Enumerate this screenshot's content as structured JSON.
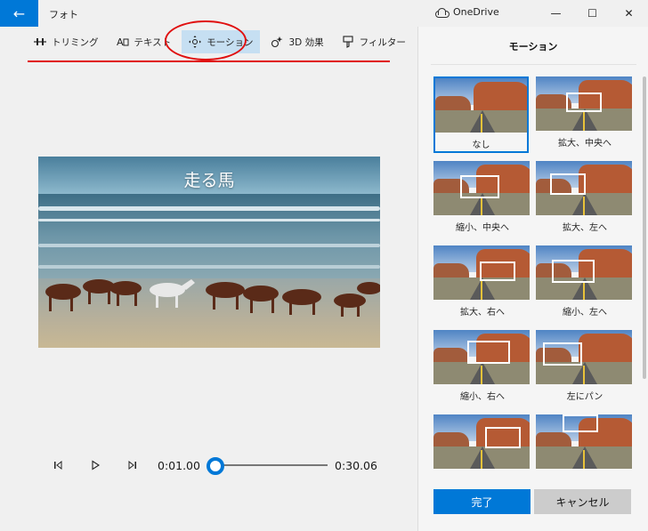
{
  "window": {
    "app_title": "フォト",
    "onedrive_label": "OneDrive",
    "minimize": "—",
    "maximize": "☐",
    "close": "✕"
  },
  "toolbar": {
    "items": [
      {
        "label": "トリミング",
        "icon": "trim-icon"
      },
      {
        "label": "テキスト",
        "icon": "text-icon"
      },
      {
        "label": "モーション",
        "icon": "motion-icon",
        "active": true
      },
      {
        "label": "3D 効果",
        "icon": "3d-effect-icon"
      },
      {
        "label": "フィルター",
        "icon": "filter-icon"
      }
    ]
  },
  "video": {
    "title_overlay": "走る馬"
  },
  "playback": {
    "current_time": "0:01.00",
    "total_time": "0:30.06",
    "progress": 0.0
  },
  "panel": {
    "title": "モーション",
    "options": [
      {
        "label": "なし",
        "selected": true
      },
      {
        "label": "拡大、中央へ"
      },
      {
        "label": "縮小、中央へ"
      },
      {
        "label": "拡大、左へ"
      },
      {
        "label": "拡大、右へ"
      },
      {
        "label": "縮小、左へ"
      },
      {
        "label": "縮小、右へ"
      },
      {
        "label": "左にパン"
      },
      {
        "label": ""
      },
      {
        "label": ""
      }
    ],
    "done_label": "完了",
    "cancel_label": "キャンセル"
  },
  "colors": {
    "accent": "#0078d7",
    "annotation_red": "#e01010",
    "active_tab": "#c6dff2"
  }
}
